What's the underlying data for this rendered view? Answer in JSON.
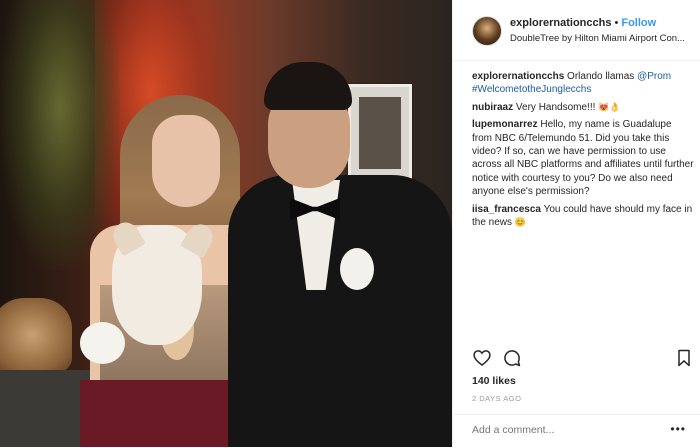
{
  "header": {
    "username": "explorernationcchs",
    "separator": "•",
    "follow_label": "Follow",
    "location": "DoubleTree by Hilton Miami Airport Con..."
  },
  "caption": {
    "username": "explorernationcchs",
    "text": "Orlando llamas",
    "tag1": "@Prom",
    "tag2": "#WelcometotheJunglecchs"
  },
  "comments": [
    {
      "username": "nubiraaz",
      "text": "Very Handsome!!!",
      "emoji": "😻👌"
    },
    {
      "username": "lupemonarrez",
      "text": "Hello, my name is Guadalupe from NBC 6/Telemundo 51. Did you take this video? If so, can we have permission to use across all NBC platforms and affiliates until further notice with courtesy to you? Do we also need anyone else's permission?"
    },
    {
      "username": "iisa_francesca",
      "text": "You could have should my face in the news",
      "emoji": "😊"
    }
  ],
  "actions": {
    "like_icon": "heart-icon",
    "comment_icon": "comment-icon",
    "save_icon": "bookmark-icon"
  },
  "likes": "140 likes",
  "time": "2 DAYS AGO",
  "add_comment_placeholder": "Add a comment...",
  "more_label": "•••"
}
